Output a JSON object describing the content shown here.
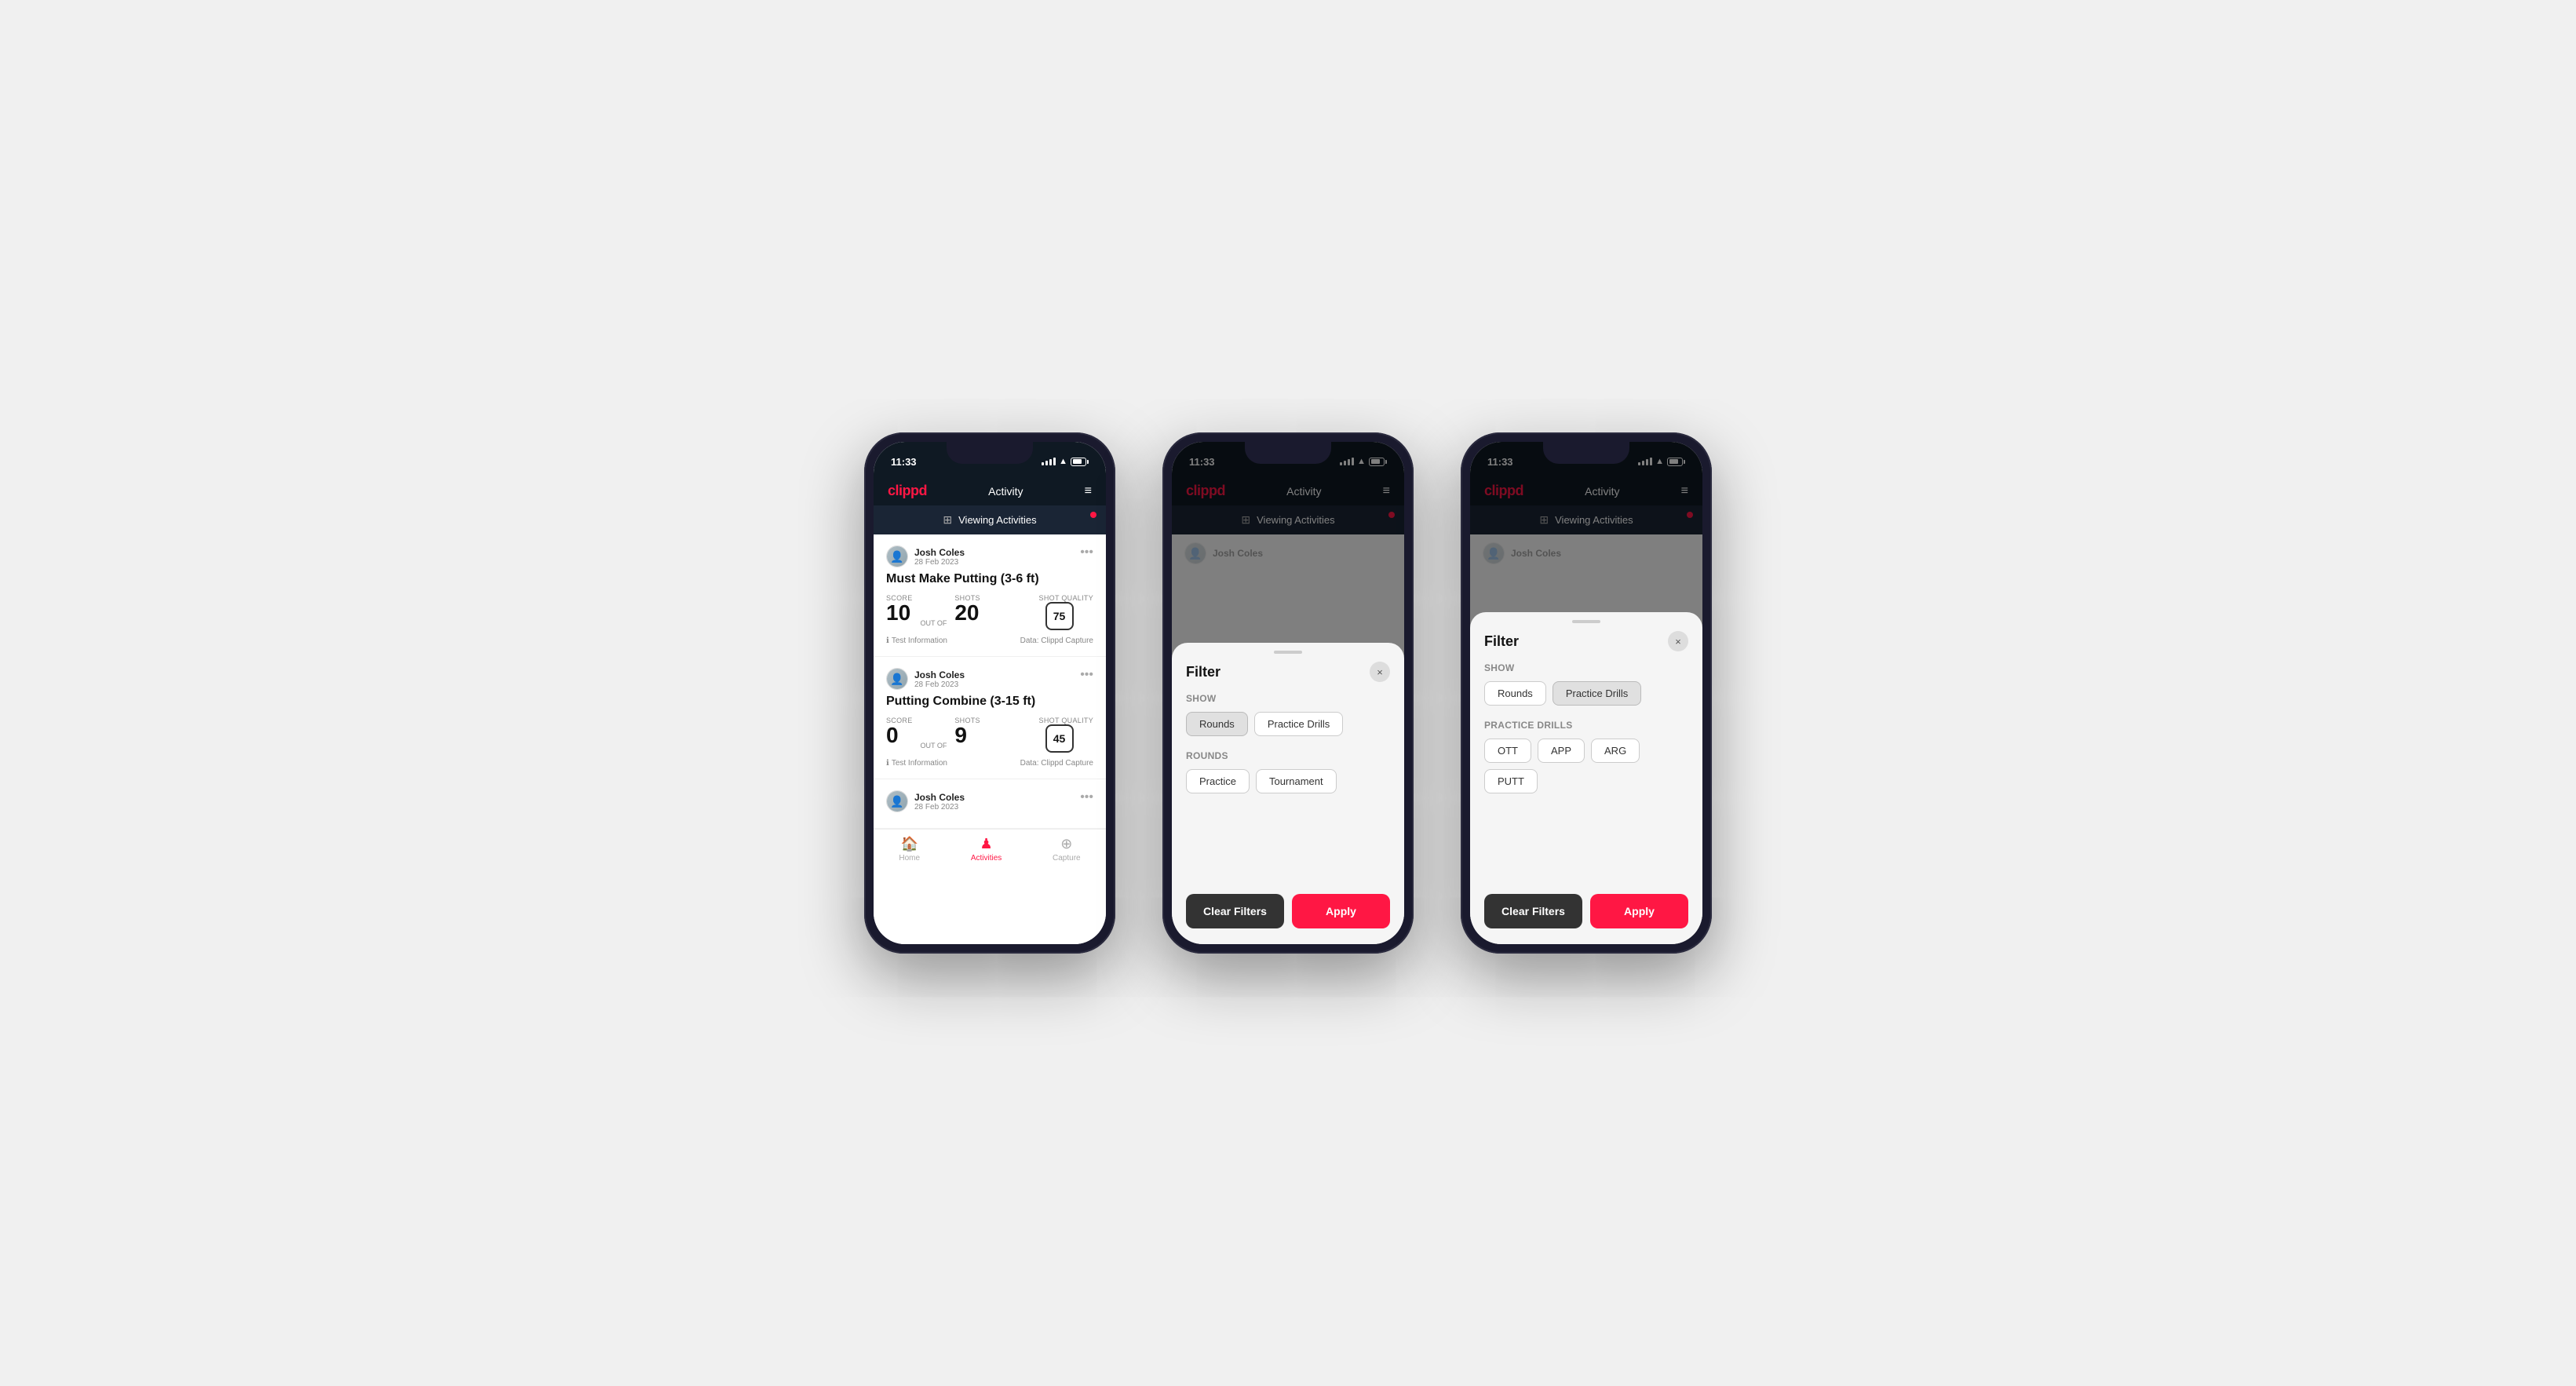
{
  "app": {
    "logo": "clippd",
    "header_title": "Activity",
    "menu_icon": "≡",
    "time": "11:33"
  },
  "phones": [
    {
      "id": "phone1",
      "type": "activity_list",
      "banner": {
        "icon": "⊞",
        "text": "Viewing Activities",
        "has_dot": true
      },
      "activities": [
        {
          "user_name": "Josh Coles",
          "user_date": "28 Feb 2023",
          "title": "Must Make Putting (3-6 ft)",
          "score_label": "Score",
          "score_value": "10",
          "out_of_label": "OUT OF",
          "out_of_value": "20",
          "shots_label": "Shots",
          "shots_value": "20",
          "shot_quality_label": "Shot Quality",
          "shot_quality_value": "75",
          "test_info": "Test Information",
          "data_source": "Data: Clippd Capture"
        },
        {
          "user_name": "Josh Coles",
          "user_date": "28 Feb 2023",
          "title": "Putting Combine (3-15 ft)",
          "score_label": "Score",
          "score_value": "0",
          "out_of_label": "OUT OF",
          "out_of_value": "9",
          "shots_label": "Shots",
          "shots_value": "9",
          "shot_quality_label": "Shot Quality",
          "shot_quality_value": "45",
          "test_info": "Test Information",
          "data_source": "Data: Clippd Capture"
        },
        {
          "user_name": "Josh Coles",
          "user_date": "28 Feb 2023",
          "title": "...",
          "score_label": "",
          "score_value": "",
          "out_of_label": "",
          "out_of_value": "",
          "shots_label": "",
          "shots_value": "",
          "shot_quality_label": "",
          "shot_quality_value": "",
          "test_info": "",
          "data_source": ""
        }
      ],
      "bottom_nav": [
        {
          "icon": "🏠",
          "label": "Home",
          "active": false
        },
        {
          "icon": "♟",
          "label": "Activities",
          "active": true
        },
        {
          "icon": "⊕",
          "label": "Capture",
          "active": false
        }
      ]
    },
    {
      "id": "phone2",
      "type": "filter_rounds",
      "banner": {
        "icon": "⊞",
        "text": "Viewing Activities",
        "has_dot": true
      },
      "filter": {
        "title": "Filter",
        "close_label": "×",
        "show_section": "Show",
        "show_chips": [
          {
            "label": "Rounds",
            "active": true
          },
          {
            "label": "Practice Drills",
            "active": false
          }
        ],
        "rounds_section": "Rounds",
        "rounds_chips": [
          {
            "label": "Practice",
            "active": false
          },
          {
            "label": "Tournament",
            "active": false
          }
        ],
        "clear_label": "Clear Filters",
        "apply_label": "Apply"
      }
    },
    {
      "id": "phone3",
      "type": "filter_practice",
      "banner": {
        "icon": "⊞",
        "text": "Viewing Activities",
        "has_dot": true
      },
      "filter": {
        "title": "Filter",
        "close_label": "×",
        "show_section": "Show",
        "show_chips": [
          {
            "label": "Rounds",
            "active": false
          },
          {
            "label": "Practice Drills",
            "active": true
          }
        ],
        "practice_section": "Practice Drills",
        "practice_chips": [
          {
            "label": "OTT",
            "active": false
          },
          {
            "label": "APP",
            "active": false
          },
          {
            "label": "ARG",
            "active": false
          },
          {
            "label": "PUTT",
            "active": false
          }
        ],
        "clear_label": "Clear Filters",
        "apply_label": "Apply"
      }
    }
  ]
}
